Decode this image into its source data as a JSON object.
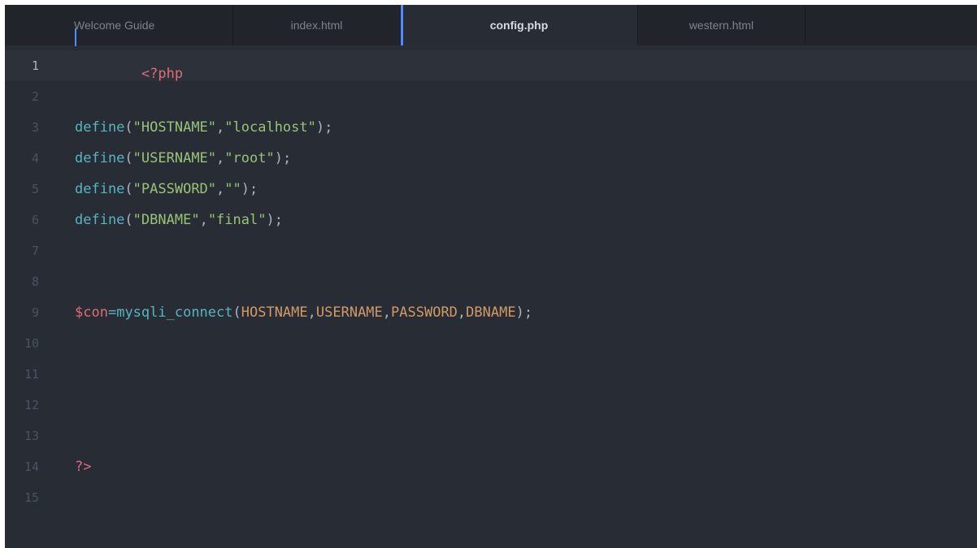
{
  "tabs": [
    {
      "label": "Welcome Guide"
    },
    {
      "label": "index.html"
    },
    {
      "label": "config.php"
    },
    {
      "label": "western.html"
    }
  ],
  "editor": {
    "line_numbers": [
      "1",
      "2",
      "3",
      "4",
      "5",
      "6",
      "7",
      "8",
      "9",
      "10",
      "11",
      "12",
      "13",
      "14",
      "15"
    ],
    "lines": {
      "l1": {
        "open_tag": "<?php"
      },
      "l3": {
        "fn": "define",
        "p1": "(",
        "s1": "\"HOSTNAME\"",
        "c": ",",
        "s2": "\"localhost\"",
        "p2": ");"
      },
      "l4": {
        "fn": "define",
        "p1": "(",
        "s1": "\"USERNAME\"",
        "c": ",",
        "s2": "\"root\"",
        "p2": ");"
      },
      "l5": {
        "fn": "define",
        "p1": "(",
        "s1": "\"PASSWORD\"",
        "c": ",",
        "s2": "\"\"",
        "p2": ");"
      },
      "l6": {
        "fn": "define",
        "p1": "(",
        "s1": "\"DBNAME\"",
        "c": ",",
        "s2": "\"final\"",
        "p2": ");"
      },
      "l9": {
        "var": "$con",
        "eq": "=",
        "fn": "mysqli_connect",
        "p1": "(",
        "a1": "HOSTNAME",
        "c1": ",",
        "a2": "USERNAME",
        "c2": ",",
        "a3": "PASSWORD",
        "c3": ",",
        "a4": "DBNAME",
        "p2": ");"
      },
      "l14": {
        "close_tag": "?>"
      }
    }
  },
  "colors": {
    "background": "#282c34",
    "tabbar": "#21252b",
    "accent": "#528bff",
    "string": "#98c379",
    "function": "#56b6c2",
    "tag": "#e06c75",
    "constant": "#d19a66"
  }
}
